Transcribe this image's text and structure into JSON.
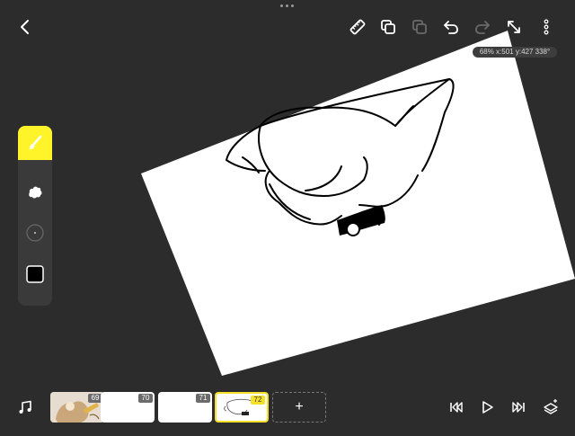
{
  "app": {
    "zoom_readout": "68% x:501 y:427 338°"
  },
  "toolbar": {
    "back": "chevron-left-icon",
    "ruler": "ruler-icon",
    "duplicate": "duplicate-icon",
    "duplicate_disabled": "duplicate-icon",
    "undo": "undo-icon",
    "redo": "redo-icon",
    "fullscreen": "expand-icon",
    "more": "more-vertical-icon"
  },
  "tools": {
    "brush": "brush-icon",
    "eraser": "eraser-icon",
    "size": "brush-size-icon",
    "color": "#000000"
  },
  "colors": {
    "accent": "#fff32a",
    "background": "#2c2c2c"
  },
  "timeline": {
    "frames": [
      {
        "number": "69"
      },
      {
        "number": "70"
      },
      {
        "number": "71"
      },
      {
        "number": "72"
      }
    ],
    "add_label": "+"
  }
}
